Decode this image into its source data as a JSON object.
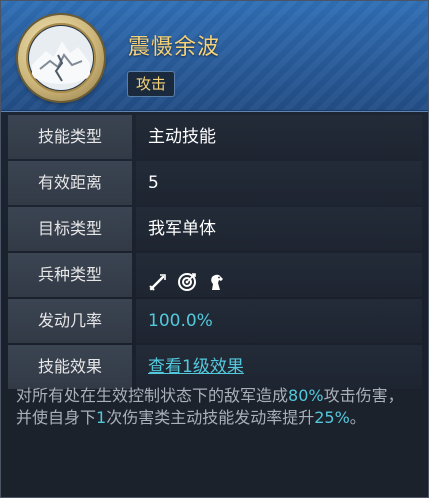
{
  "skill": {
    "name": "震慑余波",
    "tag": "攻击"
  },
  "rows": [
    {
      "label": "技能类型",
      "value": "主动技能"
    },
    {
      "label": "有效距离",
      "value": "5"
    },
    {
      "label": "目标类型",
      "value": "我军单体"
    },
    {
      "label": "兵种类型",
      "icons": [
        "sword-icon",
        "target-icon",
        "horse-icon"
      ]
    },
    {
      "label": "发动几率",
      "value": "100.0%"
    },
    {
      "label": "技能效果",
      "value": "查看1级效果"
    }
  ],
  "description": {
    "part1": "对所有处在生效控制状态下的敌军造成",
    "hl1": "80%",
    "part2": "攻击伤害，并使自身下",
    "hl2": "1",
    "part3": "次伤害类主动技能发动率提升",
    "hl3": "25%",
    "part4": "。"
  },
  "colors": {
    "name_gold": "#f5d27a",
    "highlight_cyan": "#53c8dc",
    "header_blue": "#2a5f9f"
  }
}
